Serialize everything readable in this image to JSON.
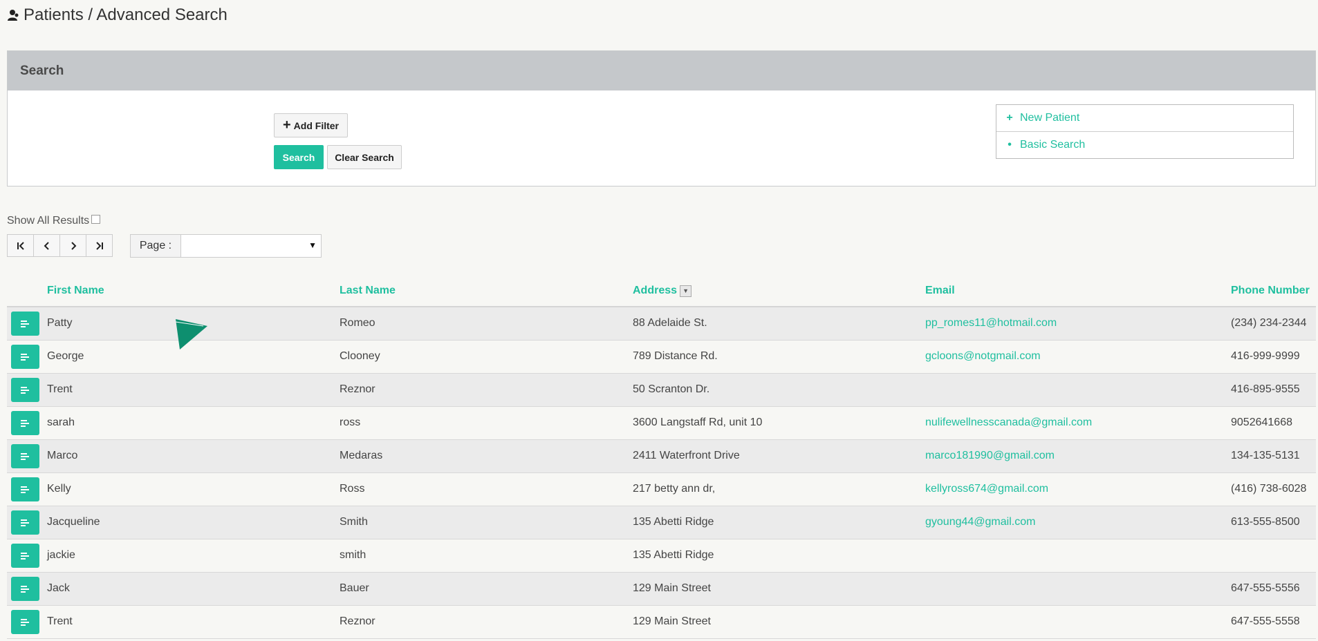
{
  "header": {
    "title": "Patients / Advanced Search"
  },
  "search_panel": {
    "title": "Search",
    "add_filter_label": "Add Filter",
    "search_label": "Search",
    "clear_label": "Clear Search"
  },
  "side_links": [
    {
      "icon": "plus",
      "label": "New Patient"
    },
    {
      "icon": "dot",
      "label": "Basic Search"
    }
  ],
  "show_all": {
    "label": "Show All Results"
  },
  "pager": {
    "page_label": "Page :",
    "page_value": ""
  },
  "table": {
    "columns": [
      "First Name",
      "Last Name",
      "Address",
      "Email",
      "Phone Number"
    ],
    "rows": [
      {
        "first": "Patty",
        "last": "Romeo",
        "address": "88 Adelaide St.",
        "email": "pp_romes11@hotmail.com",
        "phone": "(234) 234-2344"
      },
      {
        "first": "George",
        "last": "Clooney",
        "address": "789 Distance Rd.",
        "email": "gcloons@notgmail.com",
        "phone": "416-999-9999"
      },
      {
        "first": "Trent",
        "last": "Reznor",
        "address": "50 Scranton Dr.",
        "email": "",
        "phone": "416-895-9555"
      },
      {
        "first": "sarah",
        "last": "ross",
        "address": "3600 Langstaff Rd, unit 10",
        "email": "nulifewellnesscanada@gmail.com",
        "phone": "9052641668"
      },
      {
        "first": "Marco",
        "last": "Medaras",
        "address": "2411 Waterfront Drive",
        "email": "marco181990@gmail.com",
        "phone": "134-135-5131"
      },
      {
        "first": "Kelly",
        "last": "Ross",
        "address": "217 betty ann dr,",
        "email": "kellyross674@gmail.com",
        "phone": "(416) 738-6028"
      },
      {
        "first": "Jacqueline",
        "last": "Smith",
        "address": "135 Abetti Ridge",
        "email": "gyoung44@gmail.com",
        "phone": "613-555-8500"
      },
      {
        "first": "jackie",
        "last": "smith",
        "address": "135 Abetti Ridge",
        "email": "",
        "phone": ""
      },
      {
        "first": "Jack",
        "last": "Bauer",
        "address": "129 Main Street",
        "email": "",
        "phone": "647-555-5556"
      },
      {
        "first": "Trent",
        "last": "Reznor",
        "address": "129 Main Street",
        "email": "",
        "phone": "647-555-5558"
      }
    ]
  },
  "colors": {
    "accent": "#1fbf9f",
    "panel_header": "#c5c8cb"
  }
}
